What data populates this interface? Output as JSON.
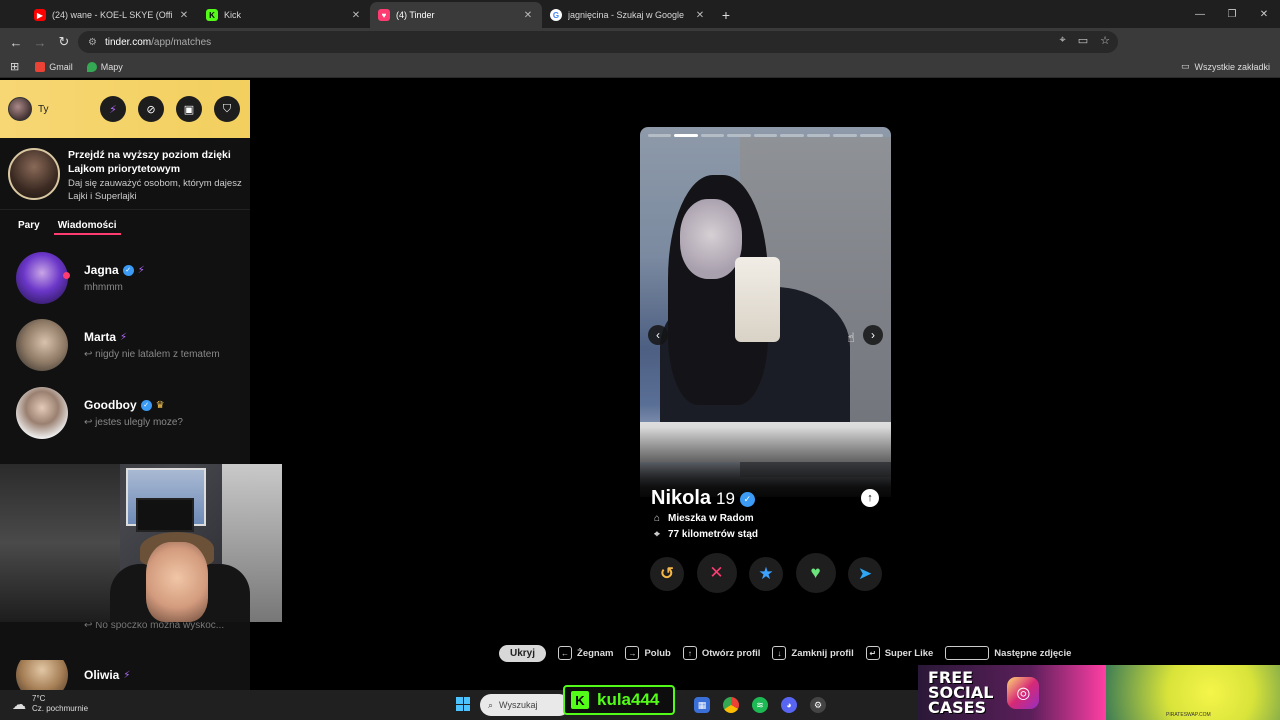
{
  "browser": {
    "tabs": [
      {
        "label": "(24) wane - KOE-L SKYE (Officia",
        "favicon": "youtube-icon",
        "color": "#ff0000",
        "active": false
      },
      {
        "label": "Kick",
        "favicon": "kick-icon",
        "color": "#53fc18",
        "active": false
      },
      {
        "label": "(4) Tinder",
        "favicon": "tinder-icon",
        "color": "#fe3c72",
        "active": true
      },
      {
        "label": "jagnięcina - Szukaj w Google",
        "favicon": "google-icon",
        "color": "#4285f4",
        "active": false
      }
    ],
    "url_domain": "tinder.com",
    "url_path": "/app/matches",
    "bookmarks": [
      {
        "label": "Gmail",
        "icon": "gmail-icon"
      },
      {
        "label": "Mapy",
        "icon": "maps-icon"
      }
    ],
    "all_bookmarks_label": "Wszystkie zakładki"
  },
  "sidebar": {
    "me_label": "Ty",
    "promo": {
      "title": "Przejdź na wyższy poziom dzięki Lajkom priorytetowym",
      "subtitle": "Daj się zauważyć osobom, którym dajesz Lajki i Superlajki"
    },
    "tabs": {
      "matches": "Pary",
      "messages": "Wiadomości"
    },
    "messages": [
      {
        "name": "Jagna",
        "preview": "mhmmm",
        "verified": true,
        "badge": "bolt-icon",
        "unread": true
      },
      {
        "name": "Marta",
        "preview": "↩ nigdy nie latalem z tematem",
        "verified": false,
        "badge": "bolt-icon",
        "unread": false
      },
      {
        "name": "Goodboy",
        "preview": "↩ jestes ulegly moze?",
        "verified": true,
        "badge": "crown-icon",
        "unread": false
      },
      {
        "name": "Oliwia",
        "preview": "",
        "verified": false,
        "badge": "bolt-icon",
        "unread": false
      }
    ],
    "partially_hidden_preview": "↩ No spoczko można wyskoc..."
  },
  "profile": {
    "name": "Nikola",
    "age": "19",
    "verified": true,
    "lives_in": "Mieszka w Radom",
    "distance": "77 kilometrów stąd",
    "photo_count": 9,
    "photo_index": 2
  },
  "shortcuts": {
    "hide_label": "Ukryj",
    "items": [
      {
        "key": "←",
        "label": "Żegnam"
      },
      {
        "key": "→",
        "label": "Polub"
      },
      {
        "key": "↑",
        "label": "Otwórz profil"
      },
      {
        "key": "↓",
        "label": "Zamknij profil"
      },
      {
        "key": "↵",
        "label": "Super Like"
      },
      {
        "key": " ",
        "label": "Następne zdjęcie"
      }
    ]
  },
  "taskbar": {
    "temperature": "7°C",
    "weather": "Cz. pochmurnie",
    "search_placeholder": "Wyszukaj",
    "weather_badge": "2"
  },
  "overlays": {
    "kick_username": "kula444",
    "ad_text": [
      "FREE",
      "SOCIAL",
      "CASES"
    ],
    "ad_footer": "PIRATESWAP.COM"
  },
  "colors": {
    "tinder_pink": "#fe3c72",
    "gold": "#f2cf5e",
    "kick_green": "#53fc18",
    "verified_blue": "#3b9bf5"
  }
}
